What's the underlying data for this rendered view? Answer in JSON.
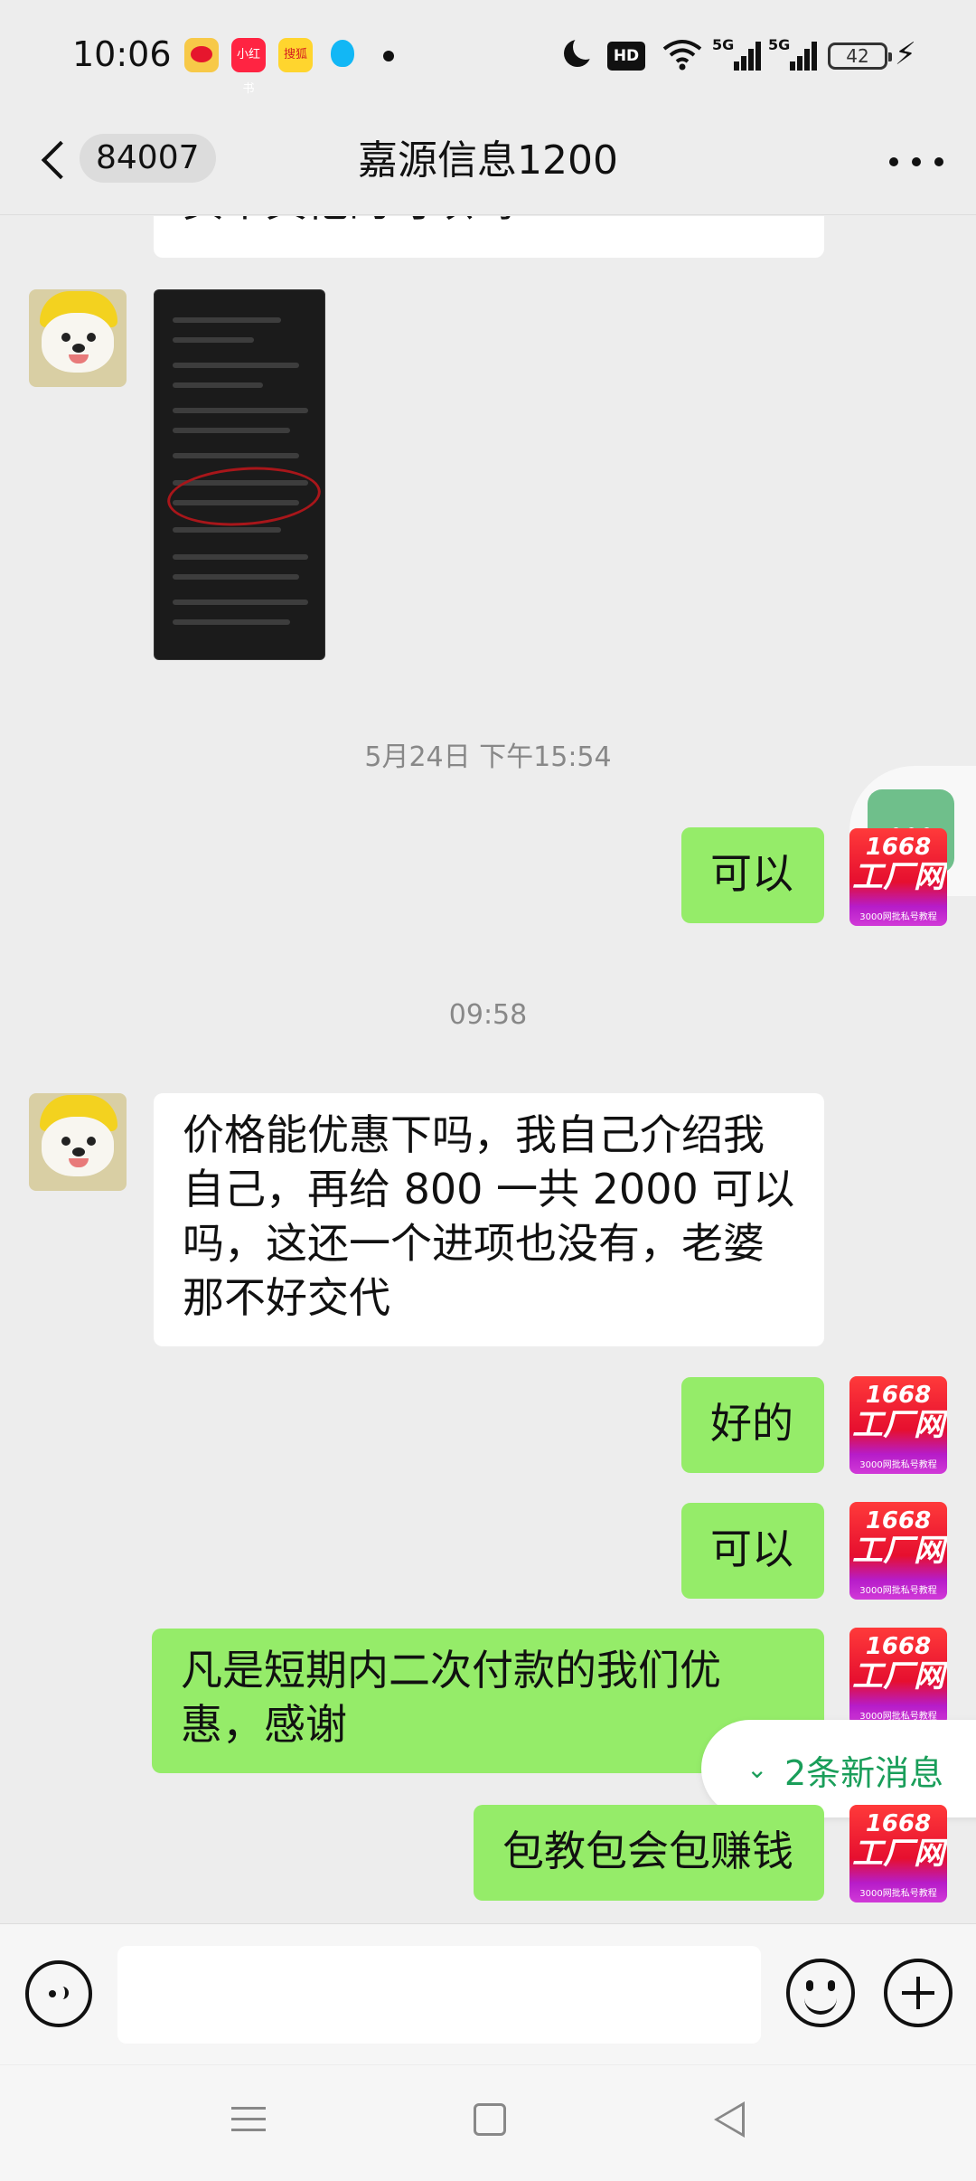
{
  "status_bar": {
    "time": "10:06",
    "apps": [
      "weibo-icon",
      "xiaohongshu-icon",
      "sohu-icon",
      "qq-icon"
    ],
    "app_labels": {
      "xiaohongshu": "小红书",
      "sohu": "搜狐"
    },
    "hd_label": "HD",
    "network_labels": [
      "5G",
      "5G"
    ],
    "battery_level": "42"
  },
  "header": {
    "unread_count": "84007",
    "title": "嘉源信息1200"
  },
  "messages": {
    "partial_top": "买个其他的可以吗",
    "timestamp_1": "5月24日 下午15:54",
    "out_1": "可以",
    "timestamp_2": "09:58",
    "in_1": "价格能优惠下吗，我自己介绍我自己，再给 800 一共 2000 可以吗，这还一个进项也没有，老婆那不好交代",
    "out_2": "好的",
    "out_3": "可以",
    "out_4": "凡是短期内二次付款的我们优惠，感谢",
    "out_5": "包教包会包赚钱"
  },
  "brand_avatar": {
    "line1": "1668",
    "line2": "工厂网",
    "line3": "3000网批私号教程"
  },
  "new_messages_pill": "2条新消息",
  "colors": {
    "background": "#ededed",
    "bubble_out": "#95ec69",
    "bubble_in": "#ffffff",
    "accent": "#1a9e5a"
  }
}
